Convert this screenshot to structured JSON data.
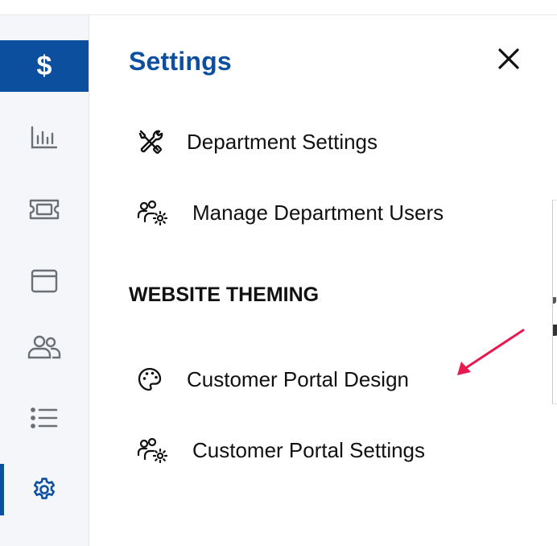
{
  "sidebar": {
    "items": [
      {
        "name": "billing",
        "icon": "dollar-icon",
        "glyph": "$",
        "active_color": "#0b4f9e"
      },
      {
        "name": "reports",
        "icon": "bar-chart-icon"
      },
      {
        "name": "tickets",
        "icon": "ticket-icon"
      },
      {
        "name": "window",
        "icon": "browser-window-icon"
      },
      {
        "name": "users",
        "icon": "users-icon"
      },
      {
        "name": "list",
        "icon": "list-icon"
      },
      {
        "name": "settings",
        "icon": "gear-icon",
        "active": true
      }
    ]
  },
  "panel": {
    "title": "Settings",
    "close_icon": "close-icon",
    "items": [
      {
        "label": "Department Settings",
        "icon": "tools-icon"
      },
      {
        "label": "Manage Department Users",
        "icon": "users-gear-icon"
      }
    ],
    "section_heading": "WEBSITE THEMING",
    "theming_items": [
      {
        "label": "Customer Portal Design",
        "icon": "palette-icon"
      },
      {
        "label": "Customer Portal Settings",
        "icon": "users-gear-icon"
      }
    ]
  },
  "colors": {
    "brand": "#0b4f9e",
    "rail_bg": "#f4f6f9",
    "annotation_arrow": "#e8194f"
  }
}
